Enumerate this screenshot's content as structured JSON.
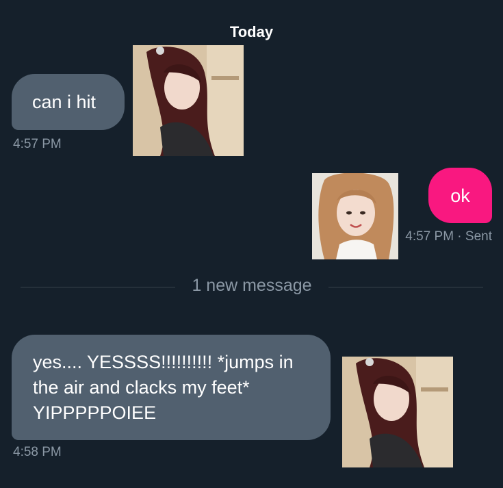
{
  "conversation": {
    "day_label": "Today",
    "new_messages_divider": "1 new message",
    "messages": [
      {
        "direction": "incoming",
        "text": "can i hit",
        "time": "4:57 PM",
        "attachment": "photo of woman with long dark red hair"
      },
      {
        "direction": "outgoing",
        "text": "ok",
        "time": "4:57 PM · Sent",
        "attachment": "photo of smiling woman with light brown hair"
      },
      {
        "direction": "incoming",
        "text": "yes.... YESSSS!!!!!!!!!! *jumps in the air and clacks my feet* YIPPPPPOIEE",
        "time": "4:58 PM",
        "attachment": "photo of woman with long dark red hair"
      }
    ]
  },
  "colors": {
    "background": "#15202b",
    "incoming_bubble": "#51606f",
    "outgoing_bubble": "#f91880",
    "timestamp": "#8b98a5",
    "divider": "#38444d"
  }
}
